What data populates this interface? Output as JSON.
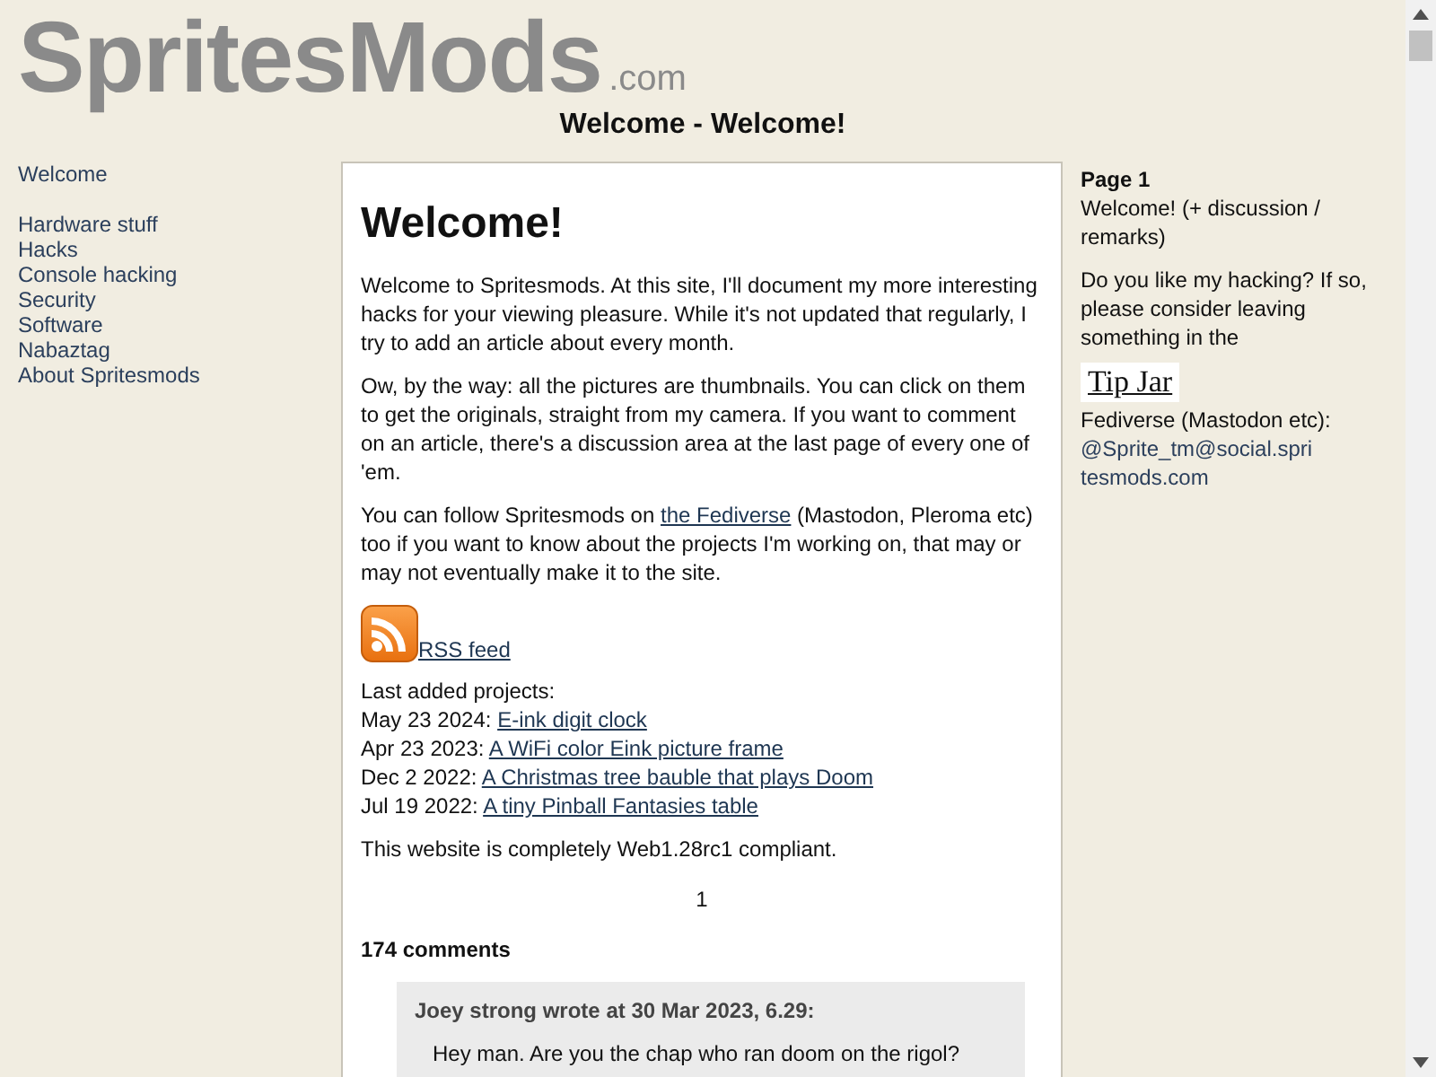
{
  "header": {
    "logo": "SpritesMods",
    "logo_suffix": ".com",
    "page_title": "Welcome - Welcome!"
  },
  "nav": [
    [
      "Welcome"
    ],
    [
      "Hardware stuff",
      "Hacks",
      "Console hacking",
      "Security",
      "Software",
      "Nabaztag",
      "About Spritesmods"
    ]
  ],
  "article": {
    "heading": "Welcome!",
    "paragraphs": [
      "Welcome to Spritesmods. At this site, I'll document my more interesting hacks for your viewing pleasure. While it's not updated that regularly, I try to add an article about every month.",
      "Ow, by the way: all the pictures are thumbnails. You can click on them to get the originals, straight from my camera. If you want to comment on an article, there's a discussion area at the last page of every one of 'em."
    ],
    "follow": {
      "before": "You can follow Spritesmods on ",
      "link": "the Fediverse",
      "after": " (Mastodon, Pleroma etc) too if you want to know about the projects I'm working on, that may or may not eventually make it to the site."
    },
    "rss_link": "RSS feed",
    "projects_heading": "Last added projects:",
    "projects": [
      {
        "date": "May 23 2024:",
        "title": "E-ink digit clock"
      },
      {
        "date": "Apr 23 2023:",
        "title": "A WiFi color Eink picture frame"
      },
      {
        "date": "Dec 2 2022:",
        "title": "A Christmas tree bauble that plays Doom"
      },
      {
        "date": "Jul 19 2022:",
        "title": "A tiny Pinball Fantasies table"
      }
    ],
    "compliance": "This website is completely Web1.28rc1 compliant.",
    "pages": [
      "1"
    ],
    "comments_count": "174 comments",
    "comments": [
      {
        "author_line": "Joey strong wrote at 30 Mar 2023, 6.29:",
        "text": "Hey man. Are you the chap who ran doom on the rigol?"
      }
    ]
  },
  "sidebar": {
    "page_label": "Page 1",
    "page_title": "Welcome! (+ discussion / remarks)",
    "donate_text": "Do you like my hacking? If so, please consider leaving something in the",
    "tip_jar": "Tip Jar",
    "fediverse_label": "Fediverse (Mastodon etc):",
    "fediverse_link": "@Sprite_tm@social.spritesmods.com"
  }
}
